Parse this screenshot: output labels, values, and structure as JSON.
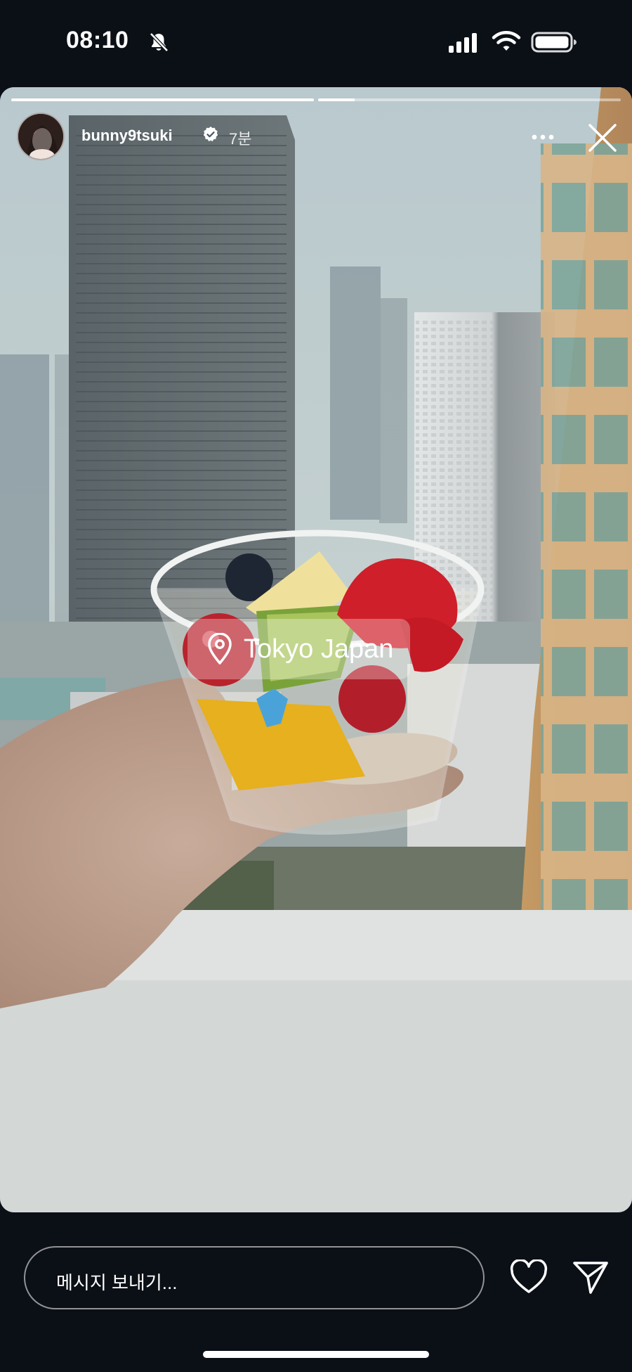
{
  "status_bar": {
    "time": "08:10",
    "icons": [
      "bell-slash-icon",
      "cellular-signal-icon",
      "wifi-icon",
      "battery-icon"
    ]
  },
  "story": {
    "progress": [
      1.0,
      0.12
    ],
    "username": "bunny9tsuki",
    "verified": true,
    "time_ago": "7분",
    "location": "Tokyo Japan"
  },
  "reply": {
    "placeholder": "메시지 보내기..."
  },
  "colors": {
    "background": "#0b0f16",
    "text": "#ffffff"
  }
}
